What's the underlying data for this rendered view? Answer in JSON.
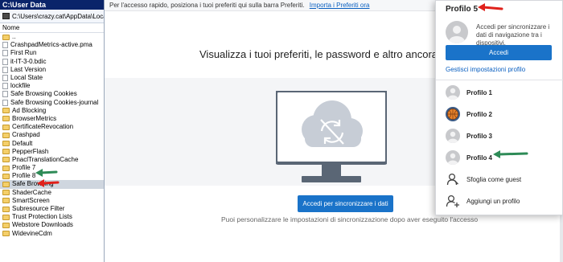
{
  "file_manager": {
    "title": "C:\\User Data",
    "path": "C:\\Users\\crazy.cat\\AppData\\Local\\M",
    "column_header": "Nome",
    "items": [
      {
        "name": "..",
        "kind": "folder",
        "selected": false
      },
      {
        "name": "CrashpadMetrics-active.pma",
        "kind": "file",
        "selected": false
      },
      {
        "name": "First Run",
        "kind": "file",
        "selected": false
      },
      {
        "name": "it-IT-3-0.bdic",
        "kind": "file",
        "selected": false
      },
      {
        "name": "Last Version",
        "kind": "file",
        "selected": false
      },
      {
        "name": "Local State",
        "kind": "file",
        "selected": false
      },
      {
        "name": "lockfile",
        "kind": "file",
        "selected": false
      },
      {
        "name": "Safe Browsing Cookies",
        "kind": "file",
        "selected": false
      },
      {
        "name": "Safe Browsing Cookies-journal",
        "kind": "file",
        "selected": false
      },
      {
        "name": "Ad Blocking",
        "kind": "folder",
        "selected": false
      },
      {
        "name": "BrowserMetrics",
        "kind": "folder",
        "selected": false
      },
      {
        "name": "CertificateRevocation",
        "kind": "folder",
        "selected": false
      },
      {
        "name": "Crashpad",
        "kind": "folder",
        "selected": false
      },
      {
        "name": "Default",
        "kind": "folder",
        "selected": false
      },
      {
        "name": "PepperFlash",
        "kind": "folder",
        "selected": false
      },
      {
        "name": "PnaclTranslationCache",
        "kind": "folder",
        "selected": false
      },
      {
        "name": "Profile 7",
        "kind": "folder",
        "selected": false
      },
      {
        "name": "Profile 8",
        "kind": "folder",
        "selected": false
      },
      {
        "name": "Safe Browsing",
        "kind": "folder",
        "selected": true
      },
      {
        "name": "ShaderCache",
        "kind": "folder",
        "selected": false
      },
      {
        "name": "SmartScreen",
        "kind": "folder",
        "selected": false
      },
      {
        "name": "Subresource Filter",
        "kind": "folder",
        "selected": false
      },
      {
        "name": "Trust Protection Lists",
        "kind": "folder",
        "selected": false
      },
      {
        "name": "Webstore Downloads",
        "kind": "folder",
        "selected": false
      },
      {
        "name": "WidevineCdm",
        "kind": "folder",
        "selected": false
      }
    ]
  },
  "browser": {
    "info_bar_text": "Per l'accesso rapido, posiziona i tuoi preferiti qui sulla barra Preferiti.",
    "info_bar_link": "Importa i Preferiti ora",
    "headline": "Visualizza i tuoi preferiti, le password e altro ancora su qualsia",
    "sync_button": "Accedi per sincronizzare i dati",
    "sync_note": "Puoi personalizzare le impostazioni di sincronizzazione dopo aver eseguito l'accesso"
  },
  "profile_menu": {
    "title": "Profilo 5",
    "description": "Accedi per sincronizzare i dati di navigazione tra i dispositivi.",
    "signin_button": "Accedi",
    "manage_link": "Gestisci impostazioni profilo",
    "profiles": [
      {
        "label": "Profilo 1",
        "icon": "person-avatar-icon"
      },
      {
        "label": "Profilo 2",
        "icon": "basketball-avatar-icon"
      },
      {
        "label": "Profilo 3",
        "icon": "person-avatar-icon"
      },
      {
        "label": "Profilo 4",
        "icon": "person-avatar-icon"
      }
    ],
    "guest_label": "Sfoglia come guest",
    "add_label": "Aggiungi un profilo"
  },
  "annotations": {
    "red": "#e0211b",
    "green": "#2e8b57"
  }
}
